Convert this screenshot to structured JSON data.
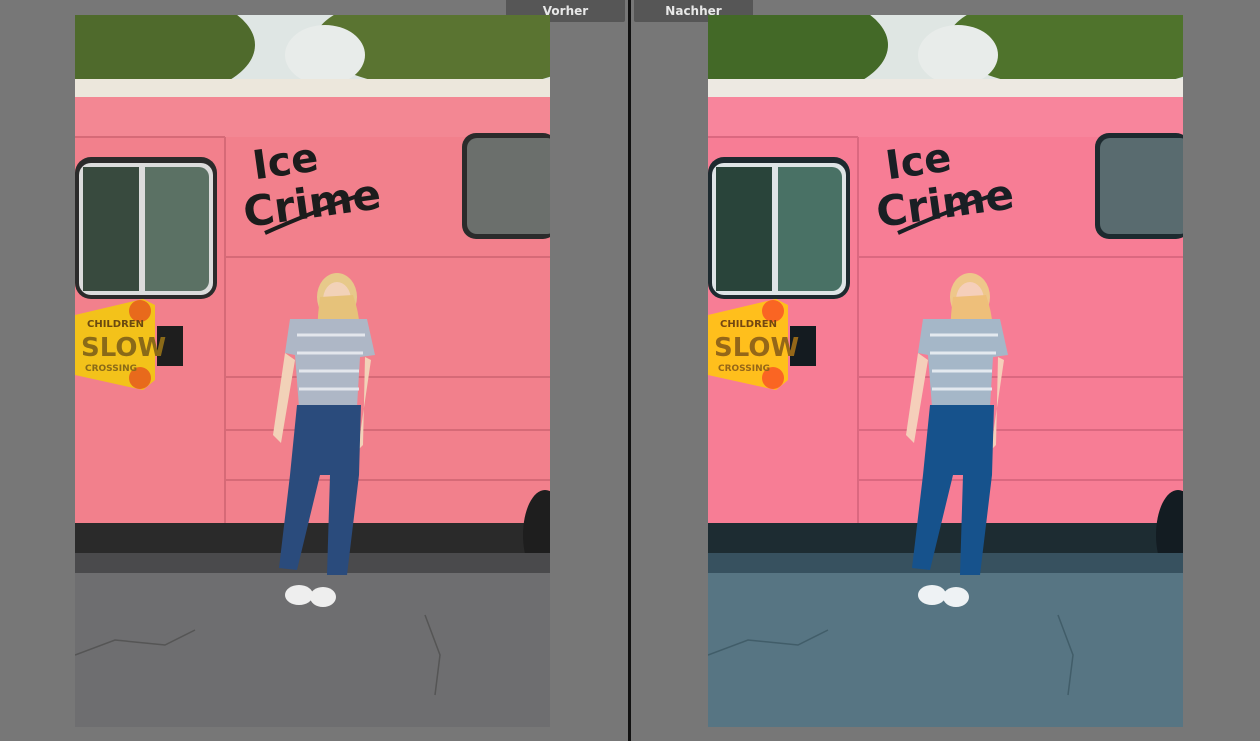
{
  "compare_view": {
    "before_label": "Vorher",
    "after_label": "Nachher"
  },
  "truck": {
    "logo_line1": "Ice",
    "logo_line2": "Crime",
    "sign_top": "CHILDREN",
    "sign_main": "SLOW",
    "sign_bottom": "CROSSING"
  },
  "colors": {
    "truck_pink": "#f2808c",
    "before_road": "#6e6e70",
    "after_road": "#5a7484",
    "after_tint": "#4a6e86"
  }
}
